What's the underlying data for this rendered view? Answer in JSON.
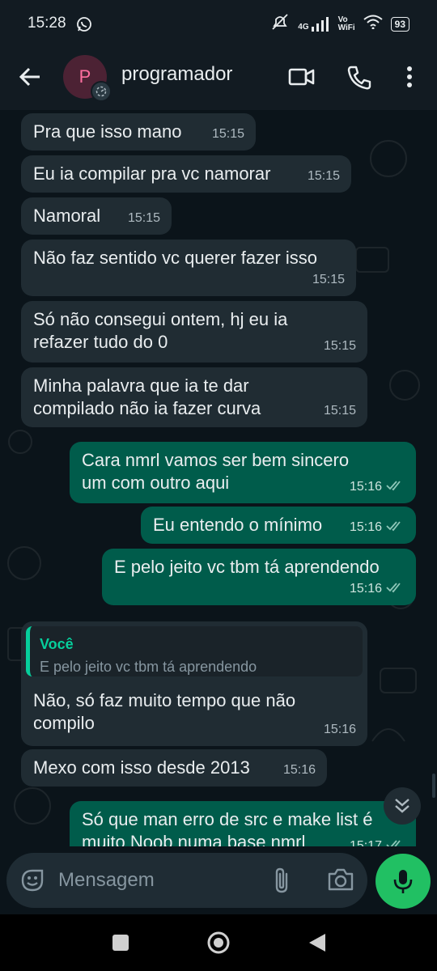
{
  "status": {
    "time": "15:28",
    "network_4g": "4G",
    "vo_label": "Vo",
    "wifi_label": "WiFi",
    "battery": "93"
  },
  "header": {
    "avatar_letter": "P",
    "contact_name": "programador"
  },
  "messages": [
    {
      "text": "Pra que isso mano",
      "time": "15:15"
    },
    {
      "text": "Eu ia compilar pra vc namorar",
      "time": "15:15"
    },
    {
      "text": "Namoral",
      "time": "15:15"
    },
    {
      "text": "Não faz sentido vc querer fazer isso",
      "time": "15:15"
    },
    {
      "text": "Só não consegui ontem, hj eu ia\nrefazer tudo do 0",
      "time": "15:15"
    },
    {
      "text": "Minha palavra que ia te dar\ncompilado não ia fazer curva",
      "time": "15:15"
    },
    {
      "text": "Cara nmrl vamos ser bem sincero\num com outro aqui",
      "time": "15:16"
    },
    {
      "text": "Eu entendo o mínimo",
      "time": "15:16"
    },
    {
      "text": "E pelo jeito vc tbm tá aprendendo",
      "time": "15:16"
    },
    {
      "quote_author": "Você",
      "quote_text": "E pelo jeito vc tbm tá aprendendo",
      "text": "Não, só faz muito tempo que não\ncompilo",
      "time": "15:16"
    },
    {
      "text": "Mexo com isso desde 2013",
      "time": "15:16"
    },
    {
      "text": "Só que man erro de src e make list é\nmuito Noob numa base nmrl",
      "time": "15:17"
    }
  ],
  "input": {
    "placeholder": "Mensagem"
  },
  "colors": {
    "incoming_bubble": "#202c33",
    "outgoing_bubble": "#005c4b",
    "accent_green": "#21c063",
    "read_ticks": "#8fc7b9"
  }
}
